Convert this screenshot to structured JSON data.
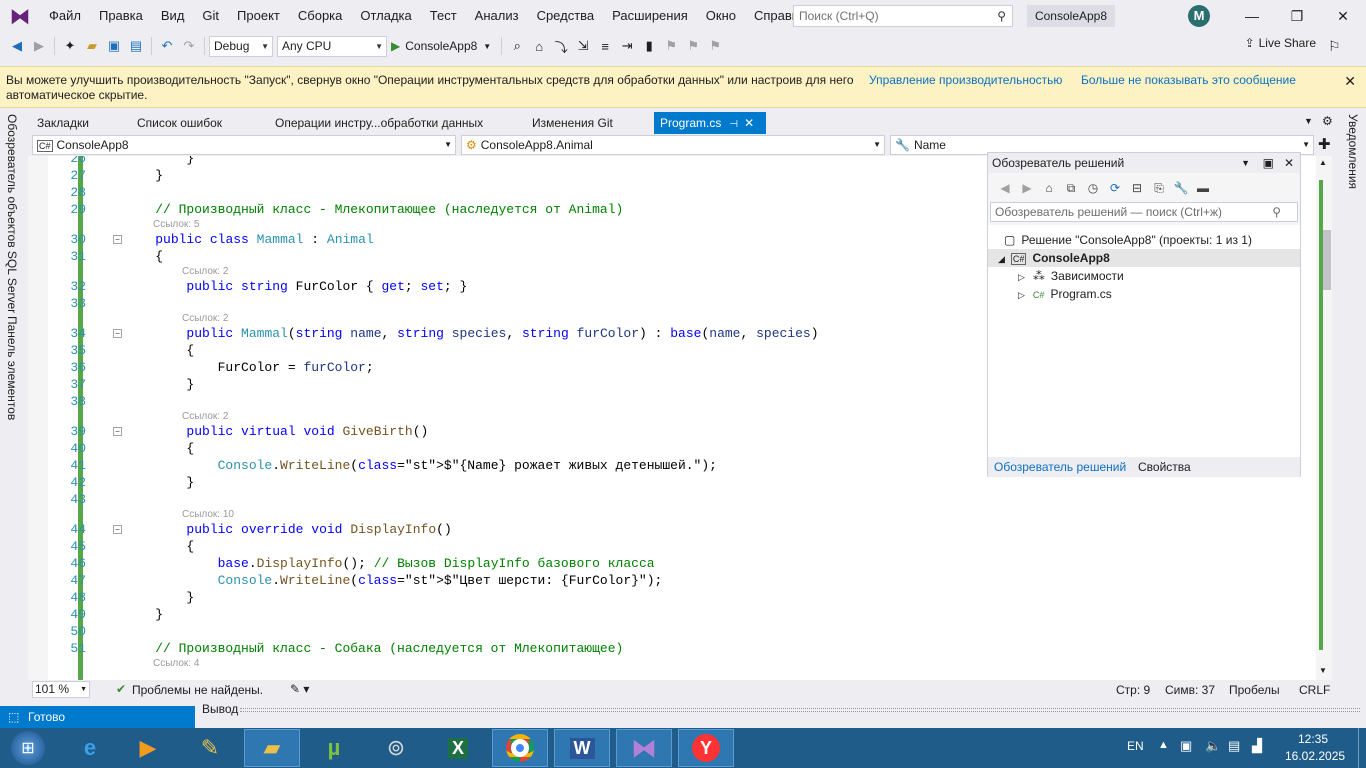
{
  "menubar": {
    "items": [
      "Файл",
      "Правка",
      "Вид",
      "Git",
      "Проект",
      "Сборка",
      "Отладка",
      "Тест",
      "Анализ",
      "Средства",
      "Расширения",
      "Окно",
      "Справка"
    ],
    "search_placeholder": "Поиск (Ctrl+Q)",
    "solution_name": "ConsoleApp8",
    "avatar_letter": "M"
  },
  "toolbar": {
    "config": "Debug",
    "platform": "Any CPU",
    "run_label": "ConsoleApp8",
    "live_share": "Live Share"
  },
  "infobar": {
    "message": "Вы можете улучшить производительность \"Запуск\", свернув окно \"Операции инструментальных средств для обработки данных\" или настроив для него автоматическое скрытие.",
    "link1": "Управление производительностью",
    "link2": "Больше не показывать это сообщение"
  },
  "left_tabs": [
    "Обозреватель объектов SQL Server",
    "Панель элементов"
  ],
  "right_tabs": [
    "Уведомления"
  ],
  "doc_tabs": [
    "Закладки",
    "Список ошибок",
    "Операции инстру...обработки данных",
    "Изменения Git",
    "Program.cs"
  ],
  "navbar": {
    "project": "ConsoleApp8",
    "class": "ConsoleApp8.Animal",
    "member": "Name"
  },
  "code": {
    "lines": [
      {
        "n": "26",
        "t": "        }"
      },
      {
        "n": "27",
        "t": "    }"
      },
      {
        "n": "28",
        "t": ""
      },
      {
        "n": "29",
        "t": "    // Производный класс - Млекопитающее (наследуется от Animal)",
        "cm": true
      },
      {
        "n": "30",
        "t": "    public class Mammal : Animal",
        "ref": "Ссылок: 5"
      },
      {
        "n": "31",
        "t": "    {"
      },
      {
        "n": "32",
        "t": "        public string FurColor { get; set; }",
        "ref": "Ссылок: 2"
      },
      {
        "n": "33",
        "t": ""
      },
      {
        "n": "34",
        "t": "        public Mammal(string name, string species, string furColor) : base(name, species)",
        "ref": "Ссылок: 2"
      },
      {
        "n": "35",
        "t": "        {"
      },
      {
        "n": "36",
        "t": "            FurColor = furColor;"
      },
      {
        "n": "37",
        "t": "        }"
      },
      {
        "n": "38",
        "t": ""
      },
      {
        "n": "39",
        "t": "        public virtual void GiveBirth()",
        "ref": "Ссылок: 2"
      },
      {
        "n": "40",
        "t": "        {"
      },
      {
        "n": "41",
        "t": "            Console.WriteLine($\"{Name} рожает живых детенышей.\");"
      },
      {
        "n": "42",
        "t": "        }"
      },
      {
        "n": "43",
        "t": ""
      },
      {
        "n": "44",
        "t": "        public override void DisplayInfo()",
        "ref": "Ссылок: 10"
      },
      {
        "n": "45",
        "t": "        {"
      },
      {
        "n": "46",
        "t": "            base.DisplayInfo(); // Вызов DisplayInfo базового класса"
      },
      {
        "n": "47",
        "t": "            Console.WriteLine($\"Цвет шерсти: {FurColor}\");"
      },
      {
        "n": "48",
        "t": "        }"
      },
      {
        "n": "49",
        "t": "    }"
      },
      {
        "n": "50",
        "t": ""
      },
      {
        "n": "51",
        "t": "    // Производный класс - Собака (наследуется от Млекопитающее)",
        "cm": true,
        "ref_after": "Ссылок: 4"
      }
    ]
  },
  "solution_explorer": {
    "title": "Обозреватель решений",
    "search_placeholder": "Обозреватель решений — поиск (Ctrl+ж)",
    "solution": "Решение \"ConsoleApp8\" (проекты: 1 из 1)",
    "project": "ConsoleApp8",
    "deps": "Зависимости",
    "file": "Program.cs",
    "tab1": "Обозреватель решений",
    "tab2": "Свойства"
  },
  "statusbar": {
    "zoom": "101 %",
    "problems": "Проблемы не найдены.",
    "line": "Стр: 9",
    "col": "Симв: 37",
    "mode": "Пробелы",
    "eol": "CRLF"
  },
  "output": {
    "ready": "Готово",
    "title": "Вывод"
  },
  "tray": {
    "lang": "EN",
    "time": "12:35",
    "date": "16.02.2025"
  }
}
